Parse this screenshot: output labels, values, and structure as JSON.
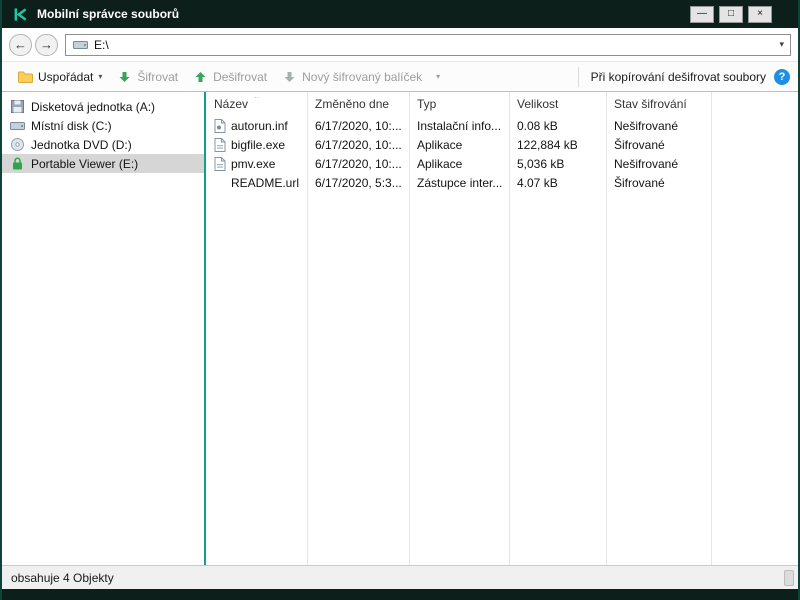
{
  "window": {
    "title": "Mobilní správce souborů"
  },
  "icons": {
    "minimize": "—",
    "maximize": "□",
    "close": "×",
    "back": "←",
    "forward": "→",
    "dropdown": "▾",
    "sort_ascending": "ˆ",
    "help": "?"
  },
  "navbar": {
    "address": "E:\\"
  },
  "toolbar": {
    "organize_label": "Uspořádat",
    "encrypt_label": "Šifrovat",
    "decrypt_label": "Dešifrovat",
    "new_package_label": "Nový šifrovaný balíček",
    "copy_decrypt_label": "Při kopírování dešifrovat soubory"
  },
  "sidebar": {
    "items": [
      {
        "label": "Disketová jednotka (A:)",
        "icon": "floppy-drive-icon",
        "selected": false
      },
      {
        "label": "Místní disk (C:)",
        "icon": "hard-disk-icon",
        "selected": false
      },
      {
        "label": "Jednotka DVD (D:)",
        "icon": "dvd-drive-icon",
        "selected": false
      },
      {
        "label": "Portable Viewer (E:)",
        "icon": "encrypted-drive-lock-icon",
        "selected": true
      }
    ]
  },
  "filelist": {
    "columns": {
      "name": "Název",
      "modified": "Změněno dne",
      "type": "Typ",
      "size": "Velikost",
      "status": "Stav šifrování"
    },
    "rows": [
      {
        "name": "autorun.inf",
        "modified": "6/17/2020, 10:...",
        "type": "Instalační info...",
        "size": "0.08 kB",
        "status": "Nešifrované",
        "icon": "setup-information-file-icon"
      },
      {
        "name": "bigfile.exe",
        "modified": "6/17/2020, 10:...",
        "type": "Aplikace",
        "size": "122,884 kB",
        "status": "Šifrované",
        "icon": "application-file-icon"
      },
      {
        "name": "pmv.exe",
        "modified": "6/17/2020, 10:...",
        "type": "Aplikace",
        "size": "5,036 kB",
        "status": "Nešifrované",
        "icon": "application-file-icon"
      },
      {
        "name": "README.url",
        "modified": "6/17/2020, 5:3...",
        "type": "Zástupce inter...",
        "size": "4.07 kB",
        "status": "Šifrované",
        "icon": ""
      }
    ]
  },
  "statusbar": {
    "text": "obsahuje 4 Objekty"
  },
  "colors": {
    "accent_teal": "#12a188",
    "titlebar_bg": "#0c1f1b",
    "selected_item_bg": "#d6d6d6",
    "help_blue": "#1f8fe5",
    "arrow_green": "#3aa35c"
  }
}
